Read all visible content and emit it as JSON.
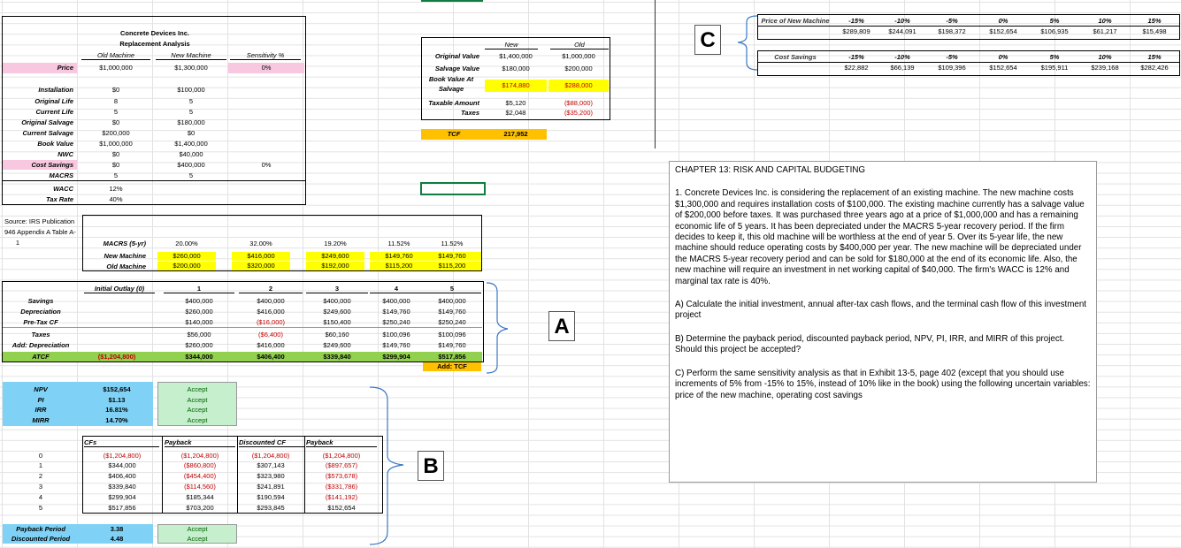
{
  "header": {
    "company": "Concrete Devices Inc.",
    "title": "Replacement Analysis"
  },
  "inputs": {
    "col_headers": [
      "Old Machine",
      "New Machine",
      "Sensitivity %"
    ],
    "price": {
      "label": "Price",
      "old": "$1,000,000",
      "new": "$1,300,000",
      "sens": "0%"
    },
    "rows": [
      {
        "label": "Installation",
        "old": "$0",
        "new": "$100,000"
      },
      {
        "label": "Original Life",
        "old": "8",
        "new": "5"
      },
      {
        "label": "Current Life",
        "old": "5",
        "new": "5"
      },
      {
        "label": "Original Salvage",
        "old": "$0",
        "new": "$180,000"
      },
      {
        "label": "Current Salvage",
        "old": "$200,000",
        "new": "$0"
      },
      {
        "label": "Book Value",
        "old": "$1,000,000",
        "new": "$1,400,000"
      },
      {
        "label": "NWC",
        "old": "$0",
        "new": "$40,000"
      },
      {
        "label": "Cost Savings",
        "old": "$0",
        "new": "$400,000",
        "sens": "0%"
      },
      {
        "label": "MACRS",
        "old": "5",
        "new": "5"
      },
      {
        "label": "WACC",
        "old": "12%",
        "new": ""
      },
      {
        "label": "Tax Rate",
        "old": "40%",
        "new": ""
      }
    ]
  },
  "salvage": {
    "headers": [
      "New",
      "Old"
    ],
    "rows": [
      {
        "label": "Original Value",
        "new": "$1,400,000",
        "old": "$1,000,000"
      },
      {
        "label": "Salvage Value",
        "new": "$180,000",
        "old": "$200,000"
      },
      {
        "label": "Book Value At Salvage",
        "new": "$174,880",
        "old": "$288,000"
      },
      {
        "label": "Taxable Amount",
        "new": "$5,120",
        "old": "($88,000)"
      },
      {
        "label": "Taxes",
        "new": "$2,048",
        "old": "($35,200)"
      }
    ],
    "tcf_label": "TCF",
    "tcf_value": "217,952"
  },
  "source": {
    "line1": "Source: IRS Publication",
    "line2": "946 Appendix A Table A-",
    "line3": "1"
  },
  "macrs": {
    "label": "MACRS (5-yr)",
    "rates": [
      "20.00%",
      "32.00%",
      "19.20%",
      "11.52%",
      "11.52%"
    ],
    "new_label": "New Machine",
    "new": [
      "$260,000",
      "$416,000",
      "$249,600",
      "$149,760",
      "$149,760"
    ],
    "old_label": "Old Machine",
    "old": [
      "$200,000",
      "$320,000",
      "$192,000",
      "$115,200",
      "$115,200"
    ]
  },
  "cashflow": {
    "outlay_label": "Initial Outlay (0)",
    "years": [
      "1",
      "2",
      "3",
      "4",
      "5"
    ],
    "rows": [
      {
        "label": "Savings",
        "vals": [
          "$400,000",
          "$400,000",
          "$400,000",
          "$400,000",
          "$400,000"
        ]
      },
      {
        "label": "Depreciation",
        "vals": [
          "$260,000",
          "$416,000",
          "$249,600",
          "$149,760",
          "$149,760"
        ]
      },
      {
        "label": "Pre-Tax CF",
        "vals": [
          "$140,000",
          "($16,000)",
          "$150,400",
          "$250,240",
          "$250,240"
        ]
      },
      {
        "label": "Taxes",
        "vals": [
          "$56,000",
          "($6,400)",
          "$60,160",
          "$100,096",
          "$100,096"
        ]
      },
      {
        "label": "Add: Depreciation",
        "vals": [
          "$260,000",
          "$416,000",
          "$249,600",
          "$149,760",
          "$149,760"
        ]
      }
    ],
    "atcf_label": "ATCF",
    "atcf_outlay": "($1,204,800)",
    "atcf": [
      "$344,000",
      "$406,400",
      "$339,840",
      "$299,904",
      "$517,856"
    ],
    "add_tcf": "Add: TCF"
  },
  "metrics": [
    {
      "label": "NPV",
      "value": "$152,654",
      "decision": "Accept"
    },
    {
      "label": "PI",
      "value": "$1.13",
      "decision": "Accept"
    },
    {
      "label": "IRR",
      "value": "16.81%",
      "decision": "Accept"
    },
    {
      "label": "MIRR",
      "value": "14.70%",
      "decision": "Accept"
    }
  ],
  "payback": {
    "headers": [
      "CFs",
      "Payback",
      "Discounted CF",
      "Payback"
    ],
    "rows": [
      {
        "yr": "0",
        "cf": "($1,204,800)",
        "pb": "($1,204,800)",
        "dcf": "($1,204,800)",
        "dpb": "($1,204,800)"
      },
      {
        "yr": "1",
        "cf": "$344,000",
        "pb": "($860,800)",
        "dcf": "$307,143",
        "dpb": "($897,657)"
      },
      {
        "yr": "2",
        "cf": "$406,400",
        "pb": "($454,400)",
        "dcf": "$323,980",
        "dpb": "($573,678)"
      },
      {
        "yr": "3",
        "cf": "$339,840",
        "pb": "($114,560)",
        "dcf": "$241,891",
        "dpb": "($331,786)"
      },
      {
        "yr": "4",
        "cf": "$299,904",
        "pb": "$185,344",
        "dcf": "$190,594",
        "dpb": "($141,192)"
      },
      {
        "yr": "5",
        "cf": "$517,856",
        "pb": "$703,200",
        "dcf": "$293,845",
        "dpb": "$152,654"
      }
    ],
    "period_label": "Payback Period",
    "period": "3.38",
    "period_decision": "Accept",
    "disc_label": "Discounted Period",
    "disc": "4.48",
    "disc_decision": "Accept"
  },
  "sensitivity": {
    "price_label": "Price of New Machine",
    "pcts": [
      "-15%",
      "-10%",
      "-5%",
      "0%",
      "5%",
      "10%",
      "15%"
    ],
    "price_vals": [
      "$289,809",
      "$244,091",
      "$198,372",
      "$152,654",
      "$106,935",
      "$61,217",
      "$15,498"
    ],
    "cost_label": "Cost Savings",
    "cost_vals": [
      "$22,882",
      "$66,139",
      "$109,396",
      "$152,654",
      "$195,911",
      "$239,168",
      "$282,426"
    ]
  },
  "labels": {
    "a": "A",
    "b": "B",
    "c": "C"
  },
  "problem": {
    "title": "CHAPTER 13: RISK AND CAPITAL BUDGETING",
    "p1": "1. Concrete Devices Inc. is considering the replacement of an existing machine. The new machine costs $1,300,000 and requires installation costs of $100,000. The existing machine currently has a salvage value of $200,000 before taxes. It was purchased three years ago at a price of $1,000,000 and has a remaining economic life of 5 years. It has been depreciated under the MACRS 5-year recovery period. If the firm decides to keep it, this old machine will be worthless at the end of year 5. Over its 5-year life, the new machine should reduce operating costs by $400,000 per year. The new machine will be depreciated under the MACRS 5-year recovery period and can be sold for $180,000 at the end of its economic life. Also, the new machine will require an investment in net working capital of $40,000. The firm's WACC is 12% and marginal tax rate is 40%.",
    "pa": "A) Calculate the initial investment, annual after-tax cash flows, and the terminal cash flow of this investment project",
    "pb": "B) Determine the payback period, discounted payback period, NPV, PI, IRR, and MIRR of this project. Should this project be accepted?",
    "pc1": "C) Perform the same sensitivity analysis as that in Exhibit 13-5, page 402 (except that you should use",
    "pc2": "increments of 5% from -15% to 15%, instead of 10% like in the book) using the following uncertain variables: price of the new machine, operating cost savings"
  }
}
